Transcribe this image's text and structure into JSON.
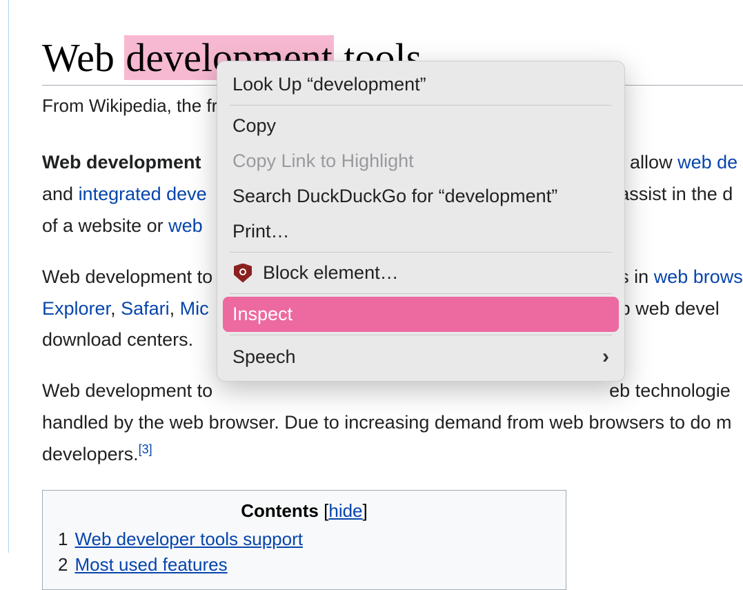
{
  "article": {
    "title_pre": "Web ",
    "title_highlight": "development",
    "title_post": " tools",
    "subtitle": "From Wikipedia, the fr",
    "p1_bold": "Web development ",
    "p1_tail1": "t) allow ",
    "p1_link1": "web de",
    "p1_line2_pre": "and ",
    "p1_link2": "integrated deve",
    "p1_tail2": " assist in the d",
    "p1_line3_pre": "of a website or ",
    "p1_link3": "web ",
    "p2_pre": "Web development to",
    "p2_mid": "s in ",
    "p2_link1": "web brows",
    "p2_line2_link1": "Explorer",
    "p2_line2_sep1": ", ",
    "p2_line2_link2": "Safari",
    "p2_line2_sep2": ", ",
    "p2_line2_link3": "Mic",
    "p2_line2_tail": "elp web devel",
    "p2_line3": "download centers.",
    "p3_pre": "Web development to",
    "p3_mid": "eb technologie",
    "p3_line2": "handled by the web browser. Due to increasing demand from web browsers to do m",
    "p3_line3_pre": "developers.",
    "p3_ref": "[3]",
    "toc": {
      "title": "Contents",
      "bracket_open": " [",
      "toggle": "hide",
      "bracket_close": "]",
      "items": [
        {
          "num": "1",
          "label": "Web developer tools support"
        },
        {
          "num": "2",
          "label": "Most used features"
        }
      ]
    }
  },
  "menu": {
    "lookup": "Look Up “development”",
    "copy": "Copy",
    "copy_link": "Copy Link to Highlight",
    "search": "Search DuckDuckGo for “development”",
    "print": "Print…",
    "block": "Block element…",
    "inspect": "Inspect",
    "speech": "Speech"
  }
}
